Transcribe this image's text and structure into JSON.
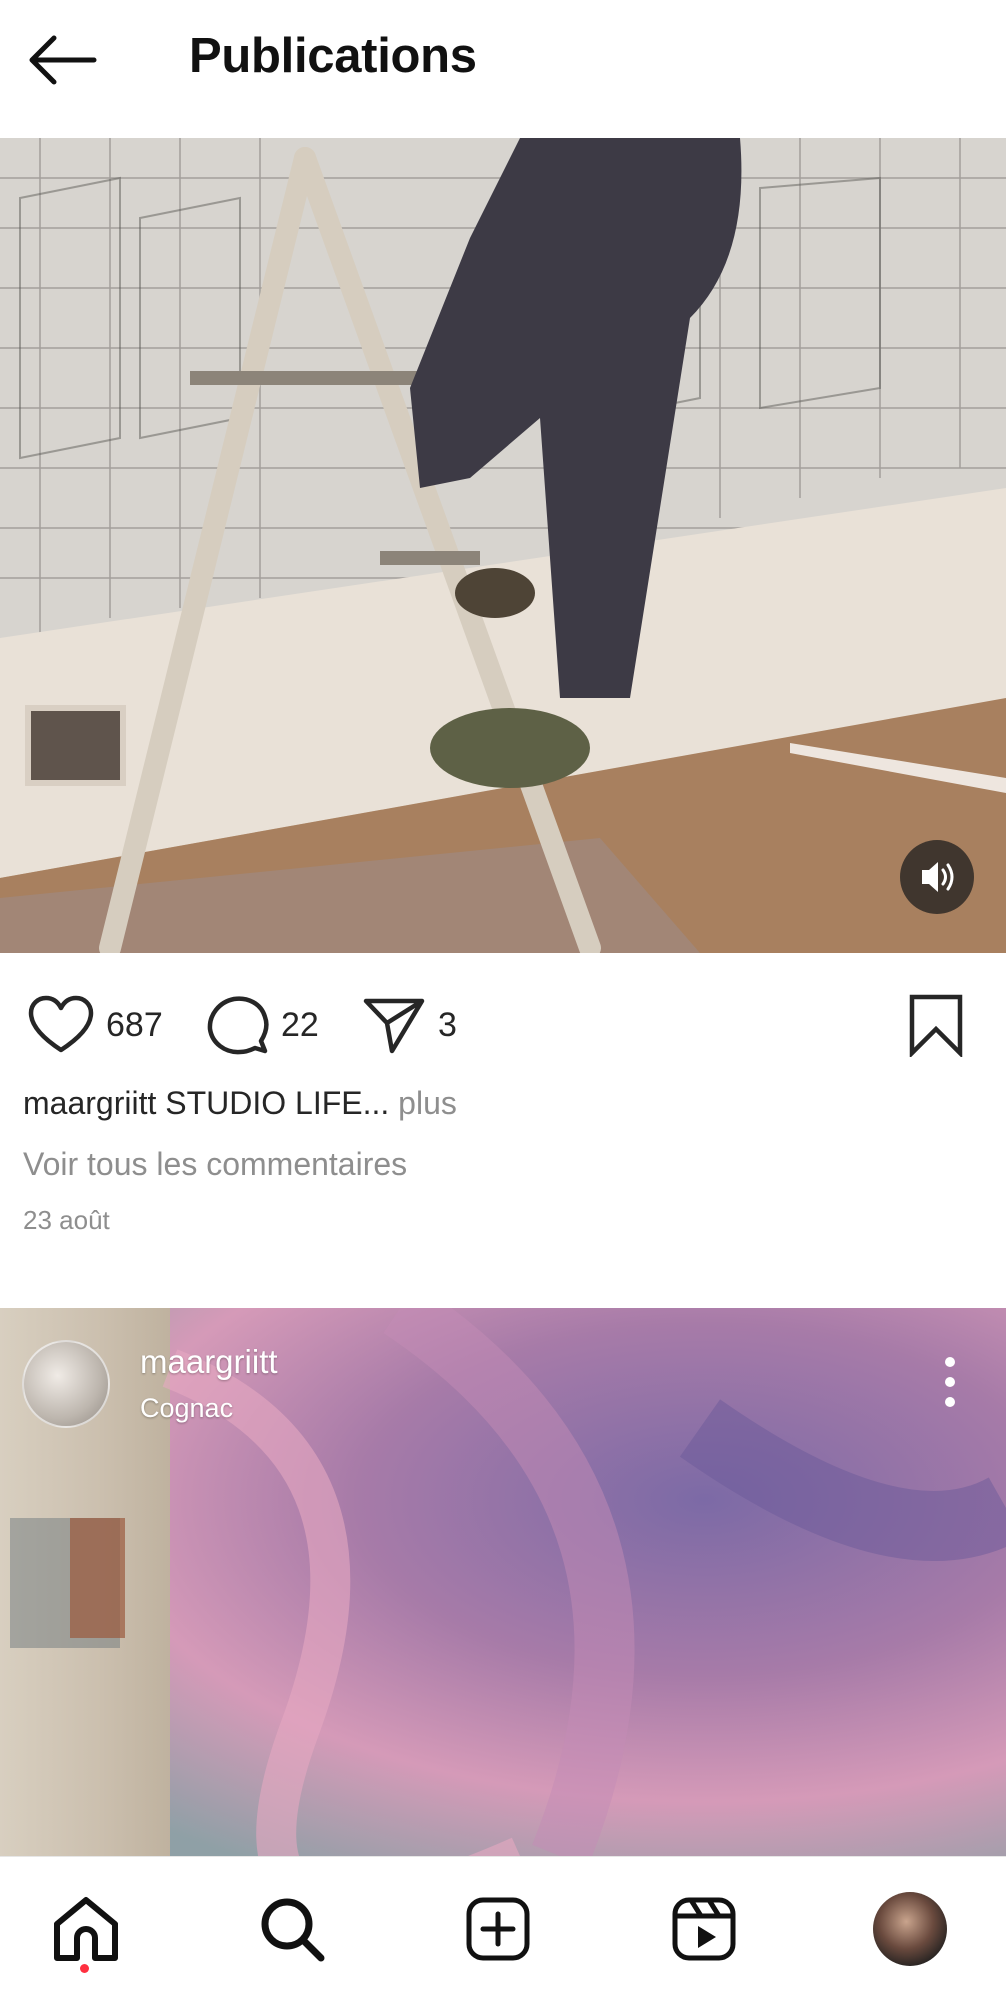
{
  "header": {
    "title": "Publications"
  },
  "post1": {
    "likes": "687",
    "comments": "22",
    "shares": "3",
    "caption_user": "maargriitt",
    "caption_text": "STUDIO  LIFE...",
    "caption_more": "plus",
    "view_comments": "Voir tous les commentaires",
    "date": "23 août"
  },
  "post2": {
    "username": "maargriitt",
    "location": "Cognac"
  },
  "colors": {
    "notification_dot": "#ff3040",
    "text": "#262626",
    "muted": "#8e8e8e"
  },
  "icons": {
    "back": "arrow-left-icon",
    "sound": "speaker-icon",
    "like": "heart-icon",
    "comment": "comment-bubble-icon",
    "share": "paper-plane-icon",
    "save": "bookmark-icon",
    "more": "more-vertical-icon",
    "home": "home-icon",
    "search": "search-icon",
    "create": "plus-square-icon",
    "reels": "reels-icon"
  }
}
